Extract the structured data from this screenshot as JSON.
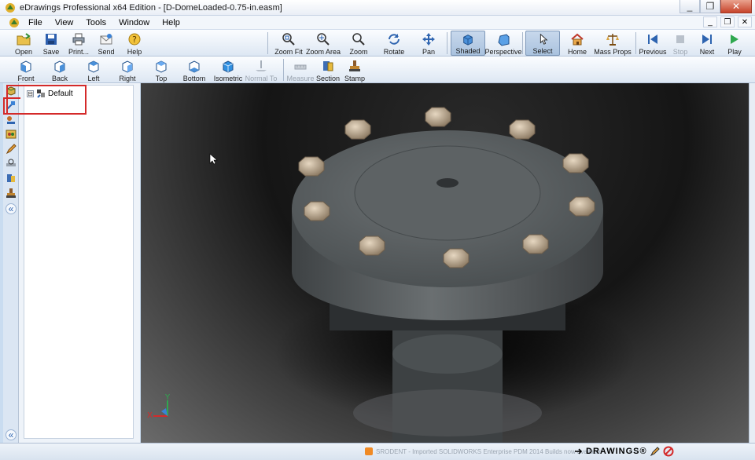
{
  "window": {
    "title": "eDrawings Professional x64 Edition - [D-DomeLoaded-0.75-in.easm]",
    "minimize": "_",
    "maximize": "❐",
    "close": "✕"
  },
  "menu": {
    "items": [
      "File",
      "View",
      "Tools",
      "Window",
      "Help"
    ],
    "mdi_minimize": "_",
    "mdi_restore": "❐",
    "mdi_close": "✕"
  },
  "toolbar_main": {
    "open": "Open",
    "save": "Save",
    "print": "Print...",
    "send": "Send",
    "help": "Help",
    "zoom_fit": "Zoom Fit",
    "zoom_area": "Zoom Area",
    "zoom": "Zoom",
    "rotate": "Rotate",
    "pan": "Pan",
    "shaded": "Shaded",
    "perspective": "Perspective",
    "select": "Select",
    "home": "Home",
    "mass_props": "Mass Props",
    "previous": "Previous",
    "stop": "Stop",
    "next": "Next",
    "play": "Play"
  },
  "toolbar_views": {
    "front": "Front",
    "back": "Back",
    "left": "Left",
    "right": "Right",
    "top": "Top",
    "bottom": "Bottom",
    "isometric": "Isometric",
    "normal_to": "Normal To",
    "measure": "Measure",
    "section": "Section",
    "stamp": "Stamp"
  },
  "tree": {
    "expander": "⊟",
    "root_label": "Default"
  },
  "strip": {
    "collapse_top": "«",
    "collapse_bottom": "«"
  },
  "triad": {
    "x": "X",
    "y": "Y"
  },
  "status": {
    "message": "SRODENT - Imported SOLIDWORKS Enterprise PDM 2014 Builds now available",
    "brand": "DRAWINGS®"
  },
  "colors": {
    "accent_blue": "#2e64b0",
    "highlight_red": "#d42a2a",
    "model_grey": "#5a5f61",
    "bolt_tan": "#b5a48f"
  }
}
